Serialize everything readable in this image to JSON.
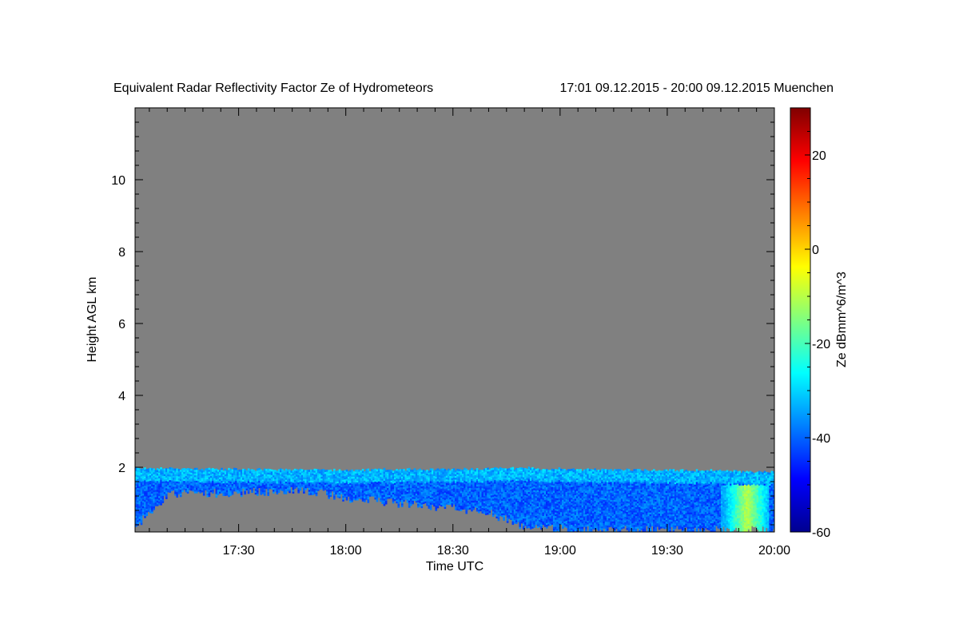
{
  "chart_data": {
    "type": "heatmap",
    "title": "Equivalent Radar Reflectivity Factor Ze of Hydrometeors",
    "subtitle": "17:01 09.12.2015 - 20:00 09.12.2015 Muenchen",
    "xlabel": "Time UTC",
    "ylabel": "Height AGL km",
    "colorbar_label": "Ze dBmm^6/m^3",
    "x_range": [
      "17:01",
      "20:00"
    ],
    "x_ticks": [
      "17:30",
      "18:00",
      "18:30",
      "19:00",
      "19:30",
      "20:00"
    ],
    "ylim": [
      0.2,
      12
    ],
    "y_ticks": [
      2,
      4,
      6,
      8,
      10
    ],
    "colorbar_range": [
      -60,
      30
    ],
    "colorbar_ticks": [
      20,
      0,
      -20,
      -40,
      -60
    ],
    "colormap": "jet",
    "no_data_color": "#808080",
    "grid": false,
    "echo_layer": {
      "top_height_km": 1.95,
      "top_height_profile_km": [
        [
          "17:01",
          1.95
        ],
        [
          "17:30",
          1.92
        ],
        [
          "18:00",
          1.9
        ],
        [
          "18:30",
          1.93
        ],
        [
          "18:50",
          1.95
        ],
        [
          "19:00",
          1.93
        ],
        [
          "19:30",
          1.9
        ],
        [
          "20:00",
          1.85
        ]
      ],
      "base_height_profile_km": [
        [
          "17:01",
          0.3
        ],
        [
          "17:10",
          1.2
        ],
        [
          "17:30",
          1.25
        ],
        [
          "17:50",
          1.3
        ],
        [
          "18:00",
          1.1
        ],
        [
          "18:20",
          0.9
        ],
        [
          "18:40",
          0.7
        ],
        [
          "18:50",
          0.25
        ],
        [
          "19:30",
          0.2
        ],
        [
          "20:00",
          0.2
        ]
      ],
      "typical_ze_dbz": -40,
      "max_ze_dbz": -10,
      "max_ze_time_window": [
        "19:45",
        "19:58"
      ],
      "max_ze_height_window_km": [
        0.2,
        1.5
      ]
    }
  }
}
